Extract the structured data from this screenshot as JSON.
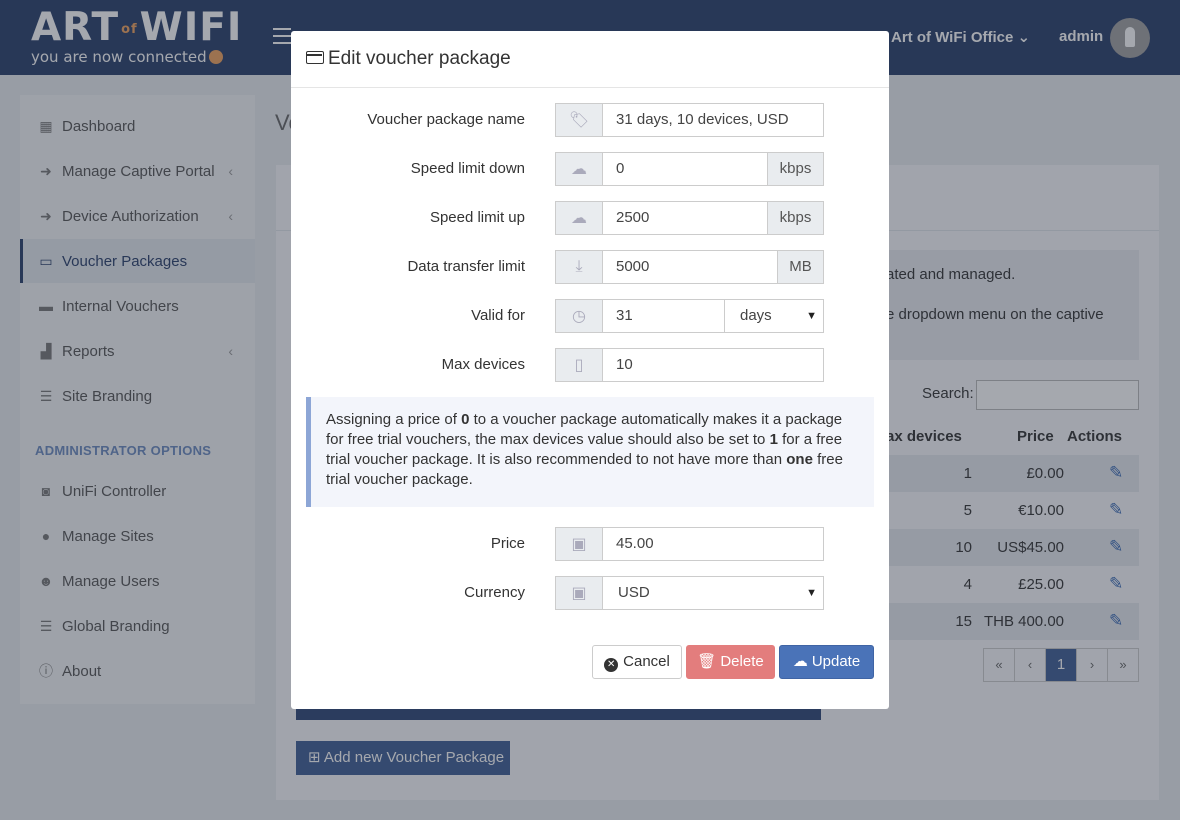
{
  "header": {
    "logo_main_left": "ART",
    "logo_main_of": "of",
    "logo_main_right": "WIFI",
    "logo_sub": "you are now connected",
    "site_name": "Art of WiFi Office",
    "site_chevron": "⌄",
    "user_name": "admin"
  },
  "sidebar": {
    "items": [
      {
        "label": "Dashboard",
        "icon": "dashboard-icon"
      },
      {
        "label": "Manage Captive Portal",
        "icon": "sign-in-icon"
      },
      {
        "label": "Device Authorization",
        "icon": "sign-in-icon"
      },
      {
        "label": "Voucher Packages",
        "icon": "credit-card-icon"
      },
      {
        "label": "Internal Vouchers",
        "icon": "ticket-icon"
      },
      {
        "label": "Reports",
        "icon": "chart-icon"
      },
      {
        "label": "Site Branding",
        "icon": "sliders-icon"
      }
    ],
    "admin_header": "ADMINISTRATOR OPTIONS",
    "admin_items": [
      {
        "label": "UniFi Controller",
        "icon": "gamepad-icon"
      },
      {
        "label": "Manage Sites",
        "icon": "map-marker-icon"
      },
      {
        "label": "Manage Users",
        "icon": "users-icon"
      },
      {
        "label": "Global Branding",
        "icon": "sliders-icon"
      },
      {
        "label": "About",
        "icon": "info-icon"
      }
    ]
  },
  "background": {
    "page_title": "Vo",
    "info_line1": "ated and managed.",
    "info_line2": "e dropdown menu on the captive",
    "search_label": "Search:",
    "columns": {
      "max_devices": "ax devices",
      "price": "Price",
      "actions": "Actions"
    },
    "rows": [
      {
        "max_devices": "1",
        "price": "£0.00"
      },
      {
        "max_devices": "5",
        "price": "€10.00"
      },
      {
        "max_devices": "10",
        "price": "US$45.00"
      },
      {
        "max_devices": "4",
        "price": "£25.00"
      },
      {
        "max_devices": "15",
        "price": "THB 400.00"
      }
    ],
    "pager": {
      "first": "«",
      "prev": "‹",
      "current": "1",
      "next": "›",
      "last": "»"
    },
    "add_button": "Add new Voucher Package"
  },
  "modal": {
    "title": "Edit voucher package",
    "fields": {
      "name": {
        "label": "Voucher package name",
        "value": "31 days, 10 devices, USD"
      },
      "speed_down": {
        "label": "Speed limit down",
        "value": "0",
        "unit": "kbps"
      },
      "speed_up": {
        "label": "Speed limit up",
        "value": "2500",
        "unit": "kbps"
      },
      "data_limit": {
        "label": "Data transfer limit",
        "value": "5000",
        "unit": "MB"
      },
      "valid_for": {
        "label": "Valid for",
        "value": "31",
        "unit": "days"
      },
      "max_devices": {
        "label": "Max devices",
        "value": "10"
      },
      "price": {
        "label": "Price",
        "value": "45.00"
      },
      "currency": {
        "label": "Currency",
        "value": "USD"
      }
    },
    "callout": {
      "t1": "Assigning a price of ",
      "b1": "0",
      "t2": " to a voucher package automatically makes it a package for free trial vouchers, the max devices value should also be set to ",
      "b2": "1",
      "t3": " for a free trial voucher package. It is also recommended to not have more than ",
      "b3": "one",
      "t4": " free trial voucher package."
    },
    "buttons": {
      "cancel": "Cancel",
      "delete": "Delete",
      "update": "Update"
    }
  }
}
